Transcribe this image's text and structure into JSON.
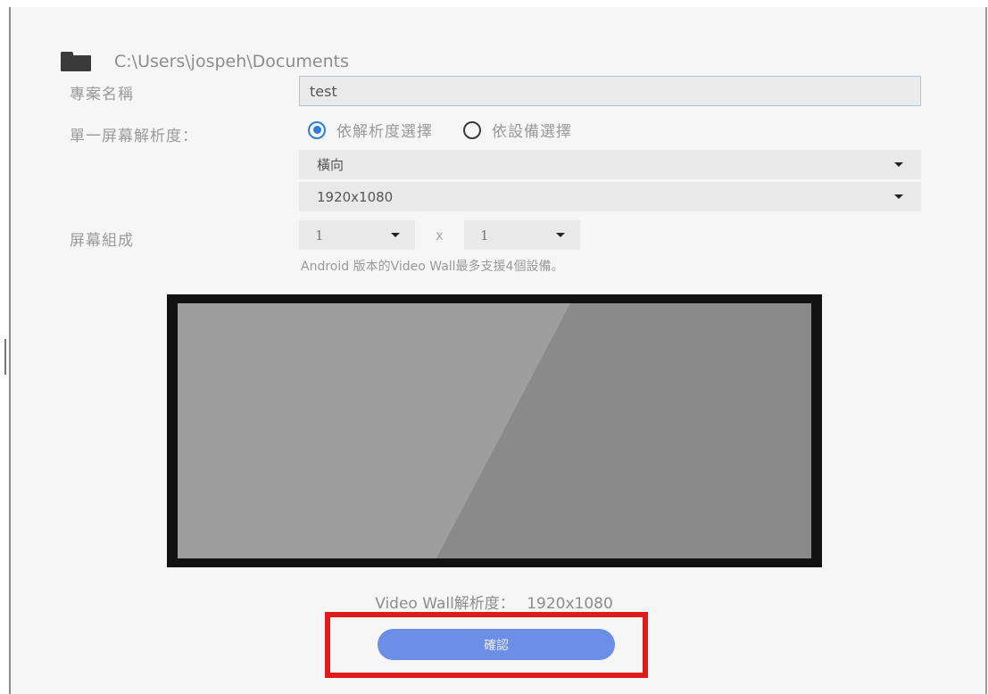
{
  "project": {
    "path": "C:\\Users\\jospeh\\Documents",
    "name_label": "專案名稱",
    "name_value": "test"
  },
  "resolution": {
    "label": "單一屏幕解析度：",
    "options": [
      {
        "label": "依解析度選擇",
        "selected": true
      },
      {
        "label": "依設備選擇",
        "selected": false
      }
    ],
    "orientation": "橫向",
    "size": "1920x1080"
  },
  "composition": {
    "label": "屏幕組成",
    "columns": "1",
    "times": "x",
    "rows": "1",
    "note": "Android 版本的Video Wall最多支援4個設備。"
  },
  "summary": {
    "label": "Video Wall解析度：",
    "value": "1920x1080"
  },
  "confirm_label": "確認",
  "colors": {
    "accent": "#2e7fd7",
    "button": "#6d8ee6",
    "highlight": "#e01b1b"
  }
}
